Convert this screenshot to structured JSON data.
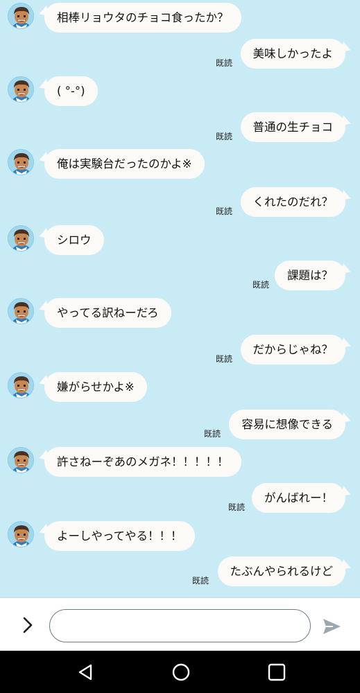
{
  "messages": [
    {
      "side": "left",
      "text": "相棒リョウタのチョコ食ったか？"
    },
    {
      "side": "right",
      "text": "美味しかったよ",
      "status": "既読"
    },
    {
      "side": "left",
      "text": "( °-°)"
    },
    {
      "side": "right",
      "text": "普通の生チョコ",
      "status": "既読"
    },
    {
      "side": "left",
      "text": "俺は実験台だったのかよ※"
    },
    {
      "side": "right",
      "text": "くれたのだれ？",
      "status": "既読"
    },
    {
      "side": "left",
      "text": "シロウ"
    },
    {
      "side": "right",
      "text": "課題は？",
      "status": "既読"
    },
    {
      "side": "left",
      "text": "やってる訳ねーだろ"
    },
    {
      "side": "right",
      "text": "だからじゃね？",
      "status": "既読"
    },
    {
      "side": "left",
      "text": "嫌がらせかよ※"
    },
    {
      "side": "right",
      "text": "容易に想像できる",
      "status": "既読"
    },
    {
      "side": "left",
      "text": "許さねーぞあのメガネ！！！！！"
    },
    {
      "side": "right",
      "text": "がんばれー！",
      "status": "既読"
    },
    {
      "side": "left",
      "text": "よーしやってやる！！！"
    },
    {
      "side": "right",
      "text": "たぶんやられるけど",
      "status": "既読"
    }
  ],
  "input": {
    "placeholder": "",
    "value": ""
  },
  "icons": {
    "expand": "chevron-right-icon",
    "send": "send-icon",
    "back": "back-triangle-icon",
    "home": "home-circle-icon",
    "recents": "recents-square-icon"
  },
  "colors": {
    "background": "#c9ebf5",
    "bubble": "#fbfaf6",
    "nav_bar": "#000000",
    "send_icon": "#9aa7af"
  }
}
